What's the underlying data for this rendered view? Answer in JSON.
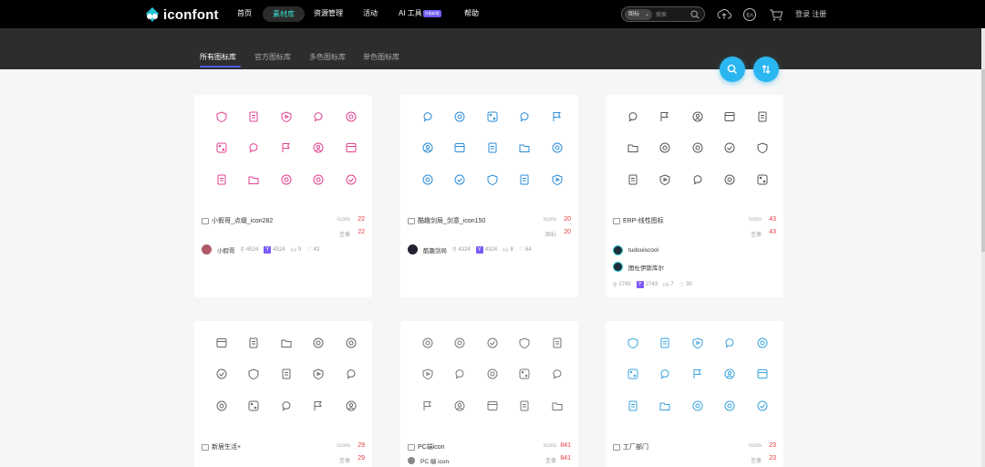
{
  "brand": {
    "logo_text": "iconfont"
  },
  "nav": {
    "home": "首页",
    "library": "素材库",
    "resources": "资源管理",
    "events": "活动",
    "ai_tools": "AI 工具",
    "ai_badge": "升级新版",
    "help": "帮助"
  },
  "search": {
    "type": "图标",
    "placeholder": "搜索"
  },
  "auth": {
    "login": "登录 注册"
  },
  "topicons": [
    "upload-icon",
    "language-icon",
    "cart-icon"
  ],
  "tabs": [
    "所有图标库",
    "官方图标库",
    "多色图标库",
    "单色图标库"
  ],
  "colors": {
    "accent": "#2ab6f0",
    "tab_underline": "#4f5cf0",
    "count_red": "#e6393d",
    "nav_active": "#38e0d3"
  },
  "cards": [
    {
      "title": "小假哥_点缀_icon282",
      "stat1_label": "icons",
      "stat1_value": "22",
      "stat2_label": "圣像",
      "stat2_value": "22",
      "author": "小假哥",
      "views": "4524",
      "copies": "4524",
      "likes": "9",
      "favs": "43",
      "icon_color": "#e0408f"
    },
    {
      "title": "酷趣剑局_剑意_icon150",
      "stat1_label": "icons",
      "stat1_value": "20",
      "stat2_label": "图标",
      "stat2_value": "20",
      "author": "酷趣剑局",
      "views": "4324",
      "copies": "4324",
      "likes": "8",
      "favs": "64",
      "icon_color": "#2a8bd6"
    },
    {
      "title": "ERP-线性图标",
      "stat1_label": "icons",
      "stat1_value": "43",
      "stat2_label": "圣像",
      "stat2_value": "43",
      "author": "tudouiscool",
      "author2": "图杜伊斯库尔",
      "views": "2743",
      "copies": "2743",
      "likes": "7",
      "favs": "30",
      "icon_color": "#555555"
    },
    {
      "title": "新居生活+",
      "stat1_label": "icons",
      "stat1_value": "29",
      "stat2_label": "圣像",
      "stat2_value": "29",
      "icon_color": "#666666"
    },
    {
      "title": "PC端icon",
      "stat1_label": "icons",
      "stat1_value": "841",
      "stat2_label": "圣像",
      "stat2_value": "841",
      "author": "PC 端 icon",
      "icon_color": "#777777"
    },
    {
      "title": "工厂部门",
      "stat1_label": "icons",
      "stat1_value": "23",
      "stat2_label": "圣像",
      "stat2_value": "23",
      "icon_color": "#3aa3dd"
    }
  ]
}
